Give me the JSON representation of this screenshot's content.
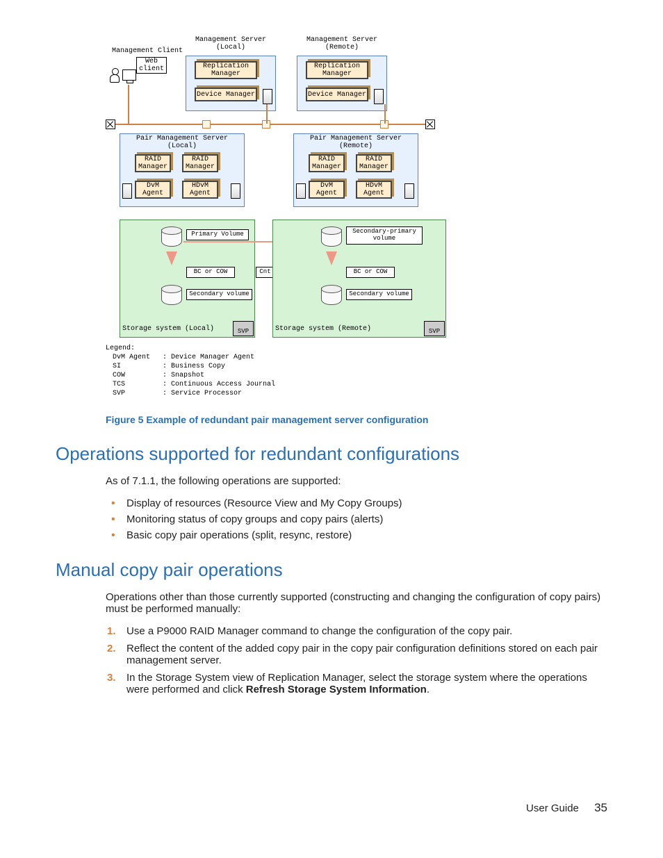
{
  "diagram": {
    "mgmt_client": "Management Client",
    "mgmt_server_local": "Management Server\n(Local)",
    "mgmt_server_remote": "Management Server\n(Remote)",
    "web_client": "Web\nclient",
    "replication_manager": "Replication\nManager",
    "device_manager": "Device Manager",
    "pair_mgmt_local": "Pair Management Server\n(Local)",
    "pair_mgmt_remote": "Pair Management Server\n(Remote)",
    "raid_manager": "RAID\nManager",
    "dvm_agent": "DvM\nAgent",
    "hdvm_agent": "HDvM\nAgent",
    "primary_volume": "Primary Volume",
    "secondary_primary_volume": "Secondary-primary\nvolume",
    "bc_or_cow": "BC or COW",
    "cnt_acj": "Cnt Ac-J",
    "secondary_volume": "Secondary volume",
    "storage_local": "Storage system (Local)",
    "storage_remote": "Storage system (Remote)",
    "svp": "SVP",
    "legend_title": "Legend:",
    "legend": [
      {
        "k": "DvM Agent",
        "v": ": Device Manager Agent"
      },
      {
        "k": "SI",
        "v": ": Business Copy"
      },
      {
        "k": "COW",
        "v": ": Snapshot"
      },
      {
        "k": "TCS",
        "v": ": Continuous Access Journal"
      },
      {
        "k": "SVP",
        "v": ": Service Processor"
      }
    ]
  },
  "figure_caption": "Figure 5 Example of redundant pair management server configuration",
  "section1_title": "Operations supported for redundant configurations",
  "section1_intro": "As of 7.1.1, the following operations are supported:",
  "section1_bullets": [
    "Display of resources (Resource View and My Copy Groups)",
    "Monitoring status of copy groups and copy pairs (alerts)",
    "Basic copy pair operations (split, resync, restore)"
  ],
  "section2_title": "Manual copy pair operations",
  "section2_intro": "Operations other than those currently supported (constructing and changing the configuration of copy pairs) must be performed manually:",
  "section2_steps": [
    "Use a P9000 RAID Manager command to change the configuration of the copy pair.",
    "Reflect the content of the added copy pair in the copy pair configuration definitions stored on each pair management server.",
    "In the Storage System view of Replication Manager, select the storage system where the operations were performed and click <b>Refresh Storage System Information</b>."
  ],
  "footer_label": "User Guide",
  "page_number": "35"
}
